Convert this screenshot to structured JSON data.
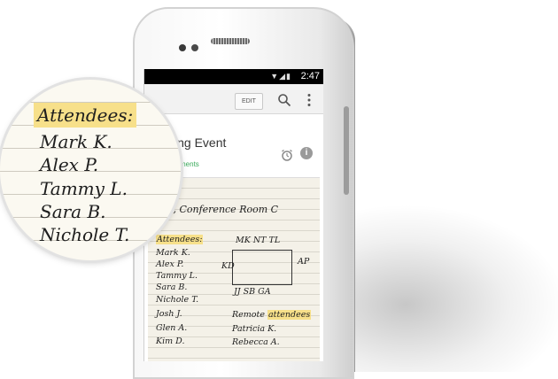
{
  "status_bar": {
    "time": "2:47"
  },
  "toolbar": {
    "edit_label": "EDIT"
  },
  "note": {
    "title": "ing Event",
    "subtitle": "ments"
  },
  "handwriting": {
    "header": "pm, Conference Room C",
    "attendees_label": "Attendees:",
    "names": [
      "Mark K.",
      "Alex P.",
      "Tammy L.",
      "Sara B.",
      "Nichole T.",
      "Josh J.",
      "Glen A.",
      "Kim D."
    ],
    "room_top": "MK NT TL",
    "room_left": "KD",
    "room_right": "AP",
    "room_bottom": "JJ SB GA",
    "remote_label": "Remote",
    "remote_highlight": "attendees",
    "remote_names": [
      "Patricia K.",
      "Rebecca A."
    ]
  },
  "magnifier": {
    "label": "Attendees:",
    "names": [
      "Mark K.",
      "Alex P.",
      "Tammy L.",
      "Sara B.",
      "Nichole T."
    ]
  },
  "colors": {
    "highlight": "#f7e08a",
    "accent_green": "#3aaa5a"
  }
}
